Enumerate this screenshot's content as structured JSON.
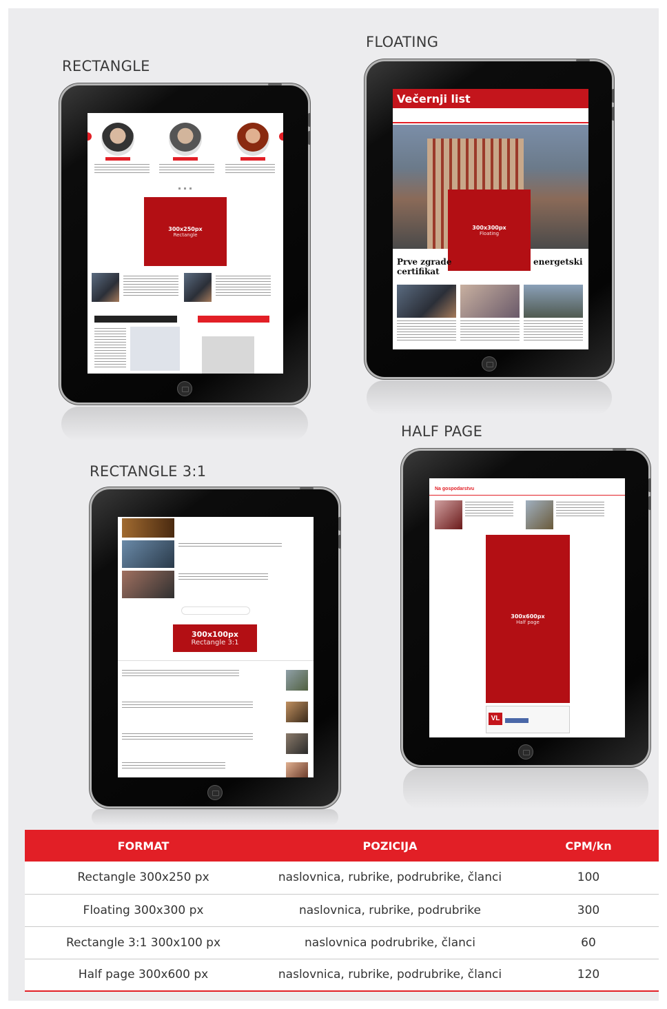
{
  "formats": {
    "rectangle": {
      "label": "RECTANGLE",
      "ad_size": "300x250px",
      "ad_name": "Rectangle"
    },
    "floating": {
      "label": "FLOATING",
      "ad_size": "300x300px",
      "ad_name": "Floating",
      "site_name": "Večernji list",
      "headline": "Prve zgrade",
      "headline_end": "energetski",
      "headline_line2": "certifikat"
    },
    "rectangle31": {
      "label": "RECTANGLE 3:1",
      "ad_size": "300x100px",
      "ad_name": "Rectangle 3:1"
    },
    "halfpage": {
      "label": "HALF PAGE",
      "ad_size": "300x600px",
      "ad_name": "Half page",
      "section_title": "Na gospodarstvu"
    }
  },
  "table": {
    "headers": [
      "FORMAT",
      "POZICIJA",
      "CPM/kn"
    ],
    "rows": [
      [
        "Rectangle 300x250 px",
        "naslovnica, rubrike, podrubrike, članci",
        "100"
      ],
      [
        "Floating 300x300 px",
        "naslovnica, rubrike, podrubrike",
        "300"
      ],
      [
        "Rectangle 3:1 300x100 px",
        "naslovnica podrubrike, članci",
        "60"
      ],
      [
        "Half page 300x600 px",
        "naslovnica, rubrike, podrubrike, članci",
        "120"
      ]
    ]
  },
  "colors": {
    "accent": "#e21f26",
    "ad_red": "#b30f14",
    "panel": "#ececee"
  }
}
